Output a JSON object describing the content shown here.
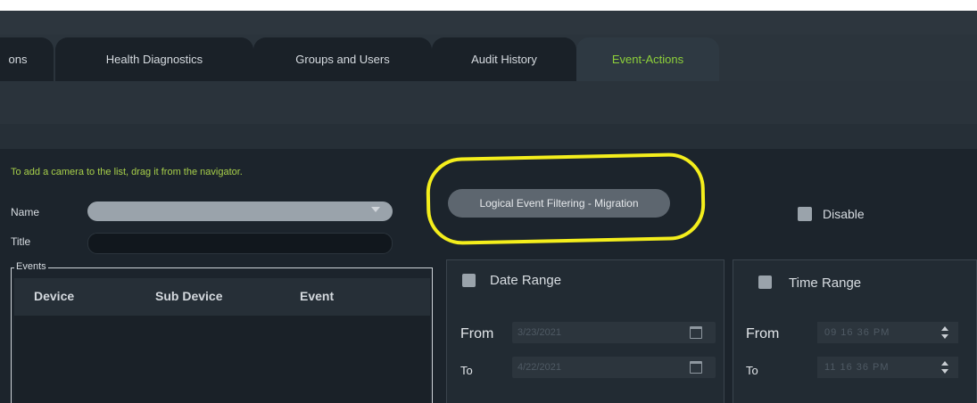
{
  "tabs": [
    {
      "label": "ons",
      "active": false
    },
    {
      "label": "Health Diagnostics",
      "active": false
    },
    {
      "label": "Groups and Users",
      "active": false
    },
    {
      "label": "Audit History",
      "active": false
    },
    {
      "label": "Event-Actions",
      "active": true
    }
  ],
  "form": {
    "hint": "To add a camera to the list, drag it from the navigator.",
    "name_label": "Name",
    "name_value": "",
    "title_label": "Title",
    "title_value": ""
  },
  "events": {
    "legend": "Events",
    "columns": [
      "Device",
      "Sub Device",
      "Event"
    ],
    "rows": []
  },
  "filter_button": "Logical Event Filtering - Migration",
  "disable_label": "Disable",
  "date_range": {
    "label": "Date Range",
    "from_label": "From",
    "from_value": "3/23/2021",
    "to_label": "To",
    "to_value": "4/22/2021"
  },
  "time_range": {
    "label": "Time Range",
    "from_label": "From",
    "from_value": "09  16  36  PM",
    "to_label": "To",
    "to_value": "11  16  36  PM"
  },
  "colors": {
    "accent_green": "#8ed13a",
    "hint_green": "#a7cf4a",
    "highlight_yellow": "#f4ee1c",
    "background": "#1c242c"
  }
}
